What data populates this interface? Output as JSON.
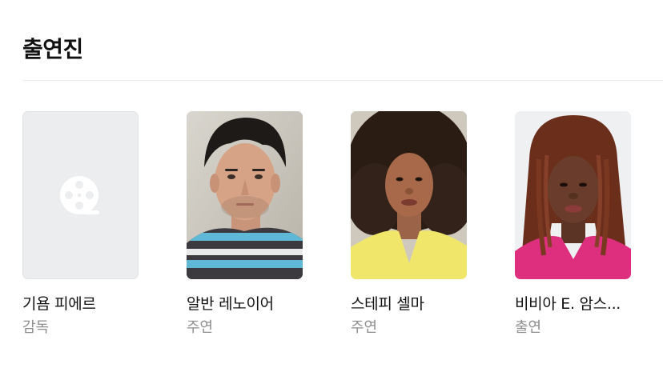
{
  "section": {
    "title": "출연진"
  },
  "cast": [
    {
      "name": "기욤 피에르",
      "role": "감독",
      "photo_icon": "film-reel-icon",
      "has_photo": false
    },
    {
      "name": "알반 레노이어",
      "role": "주연",
      "has_photo": true
    },
    {
      "name": "스테피 셀마",
      "role": "주연",
      "has_photo": true
    },
    {
      "name": "비비아 E. 암스...",
      "role": "출연",
      "has_photo": true
    }
  ],
  "colors": {
    "title": "#111111",
    "role_text": "#8e8e8e",
    "placeholder_bg": "#ecedef",
    "divider": "#ebebeb"
  }
}
